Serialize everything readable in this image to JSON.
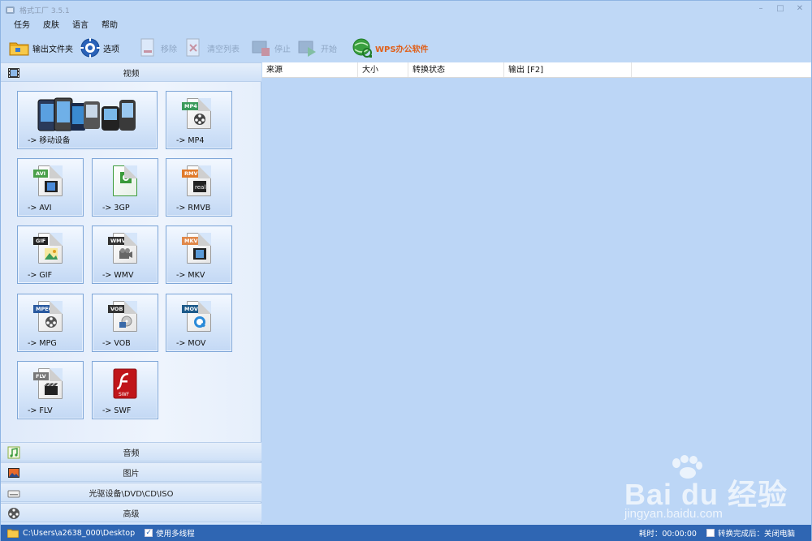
{
  "window": {
    "title": "格式工厂 3.5.1",
    "controls": [
      "–",
      "□",
      "✕"
    ]
  },
  "menu": [
    "任务",
    "皮肤",
    "语言",
    "帮助"
  ],
  "toolbar": [
    {
      "label": "输出文件夹",
      "icon": "folder-icon",
      "enabled": true
    },
    {
      "label": "选项",
      "icon": "gear-icon",
      "enabled": true
    },
    {
      "label": "移除",
      "icon": "remove-icon",
      "enabled": false
    },
    {
      "label": "清空列表",
      "icon": "clear-list-icon",
      "enabled": false
    },
    {
      "label": "停止",
      "icon": "stop-icon",
      "enabled": false
    },
    {
      "label": "开始",
      "icon": "start-icon",
      "enabled": false
    },
    {
      "label": "WPS办公软件",
      "icon": "wps-globe-icon",
      "enabled": true
    }
  ],
  "categories": {
    "video": "视频",
    "audio": "音频",
    "image": "图片",
    "disc": "光驱设备\\DVD\\CD\\ISO",
    "advanced": "高级"
  },
  "tiles": {
    "mobile": "-> 移动设备",
    "mp4": {
      "label": "-> MP4",
      "tag": "MP4",
      "color": "#3a9a5a"
    },
    "avi": {
      "label": "-> AVI",
      "tag": "AVI",
      "color": "#4aa04a"
    },
    "3gp": {
      "label": "-> 3GP",
      "tag": "",
      "color": "#3a9a3a"
    },
    "rmvb": {
      "label": "-> RMVB",
      "tag": "RMVB",
      "color": "#e07a2a"
    },
    "gif": {
      "label": "-> GIF",
      "tag": "GIF",
      "color": "#222222"
    },
    "wmv": {
      "label": "-> WMV",
      "tag": "WMV",
      "color": "#333333"
    },
    "mkv": {
      "label": "-> MKV",
      "tag": "MKV",
      "color": "#e0884a"
    },
    "mpg": {
      "label": "-> MPG",
      "tag": "MPEG",
      "color": "#2a5aa0"
    },
    "vob": {
      "label": "-> VOB",
      "tag": "VOB",
      "color": "#333333"
    },
    "mov": {
      "label": "-> MOV",
      "tag": "MOV",
      "color": "#1d5a8a"
    },
    "flv": {
      "label": "-> FLV",
      "tag": "FLV",
      "color": "#777777"
    },
    "swf": {
      "label": "-> SWF",
      "tag": "SWF",
      "color": "#c0151a"
    }
  },
  "list": {
    "columns": [
      "来源",
      "大小",
      "转换状态",
      "输出 [F2]"
    ]
  },
  "status": {
    "path": "C:\\Users\\a2638_000\\Desktop",
    "multithread": "使用多线程",
    "elapsed": "耗时：00:00:00",
    "after_done": "转换完成后：关闭电脑"
  },
  "watermark": {
    "brand": "Bai du 经验",
    "url": "jingyan.baidu.com"
  }
}
